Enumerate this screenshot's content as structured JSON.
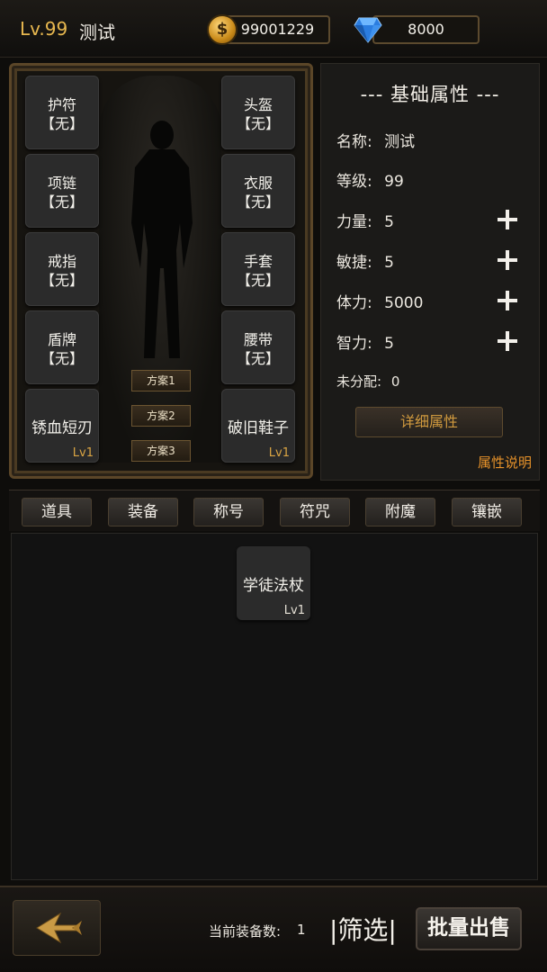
{
  "topbar": {
    "level": "Lv.99",
    "player_name": "测试",
    "gold_amount": "99001229",
    "gem_amount": "8000",
    "coin_icon": "coin-icon",
    "gem_icon": "diamond-icon"
  },
  "equipment": {
    "slots": [
      {
        "name": "护符",
        "state": "【无】"
      },
      {
        "name": "头盔",
        "state": "【无】"
      },
      {
        "name": "项链",
        "state": "【无】"
      },
      {
        "name": "衣服",
        "state": "【无】"
      },
      {
        "name": "戒指",
        "state": "【无】"
      },
      {
        "name": "手套",
        "state": "【无】"
      },
      {
        "name": "盾牌",
        "state": "【无】"
      },
      {
        "name": "腰带",
        "state": "【无】"
      }
    ],
    "weapon": {
      "name": "锈血短刃",
      "level": "Lv1"
    },
    "shoes": {
      "name": "破旧鞋子",
      "level": "Lv1"
    },
    "plans": [
      "方案1",
      "方案2",
      "方案3"
    ]
  },
  "attributes": {
    "title": "--- 基础属性 ---",
    "name_label": "名称:",
    "name_value": "测试",
    "level_label": "等级:",
    "level_value": "99",
    "strength_label": "力量:",
    "strength_value": "5",
    "agility_label": "敏捷:",
    "agility_value": "5",
    "stamina_label": "体力:",
    "stamina_value": "5000",
    "intellect_label": "智力:",
    "intellect_value": "5",
    "unassigned_label": "未分配:",
    "unassigned_value": "0",
    "detail_button": "详细属性",
    "help_link": "属性说明"
  },
  "tabs": [
    "道具",
    "装备",
    "称号",
    "符咒",
    "附魔",
    "镶嵌"
  ],
  "inventory": {
    "items": [
      {
        "name": "学徒法杖",
        "level": "Lv1"
      }
    ]
  },
  "bottom": {
    "count_label": "当前装备数:",
    "count_value": "1",
    "filter_label": "|筛选|",
    "sell_label": "批量出售",
    "back_icon": "back-arrow-icon"
  },
  "colors": {
    "accent_gold": "#e8b84f",
    "help_orange": "#e7922a",
    "level_tag": "#d9a443"
  }
}
